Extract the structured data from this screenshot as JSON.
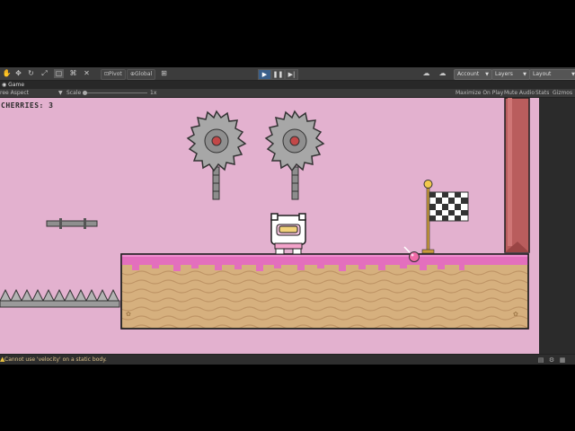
{
  "toolbar": {
    "pivot_label": "Pivot",
    "global_label": "Global",
    "account_label": "Account",
    "layers_label": "Layers",
    "layout_label": "Layout"
  },
  "tab": {
    "label": "Game"
  },
  "game_toolbar": {
    "aspect_label": "ree Aspect",
    "scale_label": "Scale",
    "scale_value": "1x",
    "maximize_label": "Maximize On Play",
    "mute_label": "Mute Audio",
    "stats_label": "Stats",
    "gizmos_label": "Gizmos"
  },
  "hud": {
    "cherries_text": "CHERRIES: 3"
  },
  "console": {
    "message": "Cannot use 'velocity' on a static body."
  },
  "colors": {
    "background": "#e3b1cf",
    "frosting": "#e36fbd",
    "dirt": "#d6b07e",
    "wall": "#b95d5d",
    "play_active": "#3a5f8a"
  },
  "icons": {
    "tools": [
      "hand-icon",
      "move-icon",
      "rotate-icon",
      "scale-icon",
      "rect-tool-icon",
      "transform-icon",
      "custom-tool-icon"
    ],
    "right": [
      "cloud-icon",
      "search-icon"
    ],
    "status": [
      "warning-icon",
      "console-icon",
      "settings-icon",
      "layout-icon"
    ]
  }
}
